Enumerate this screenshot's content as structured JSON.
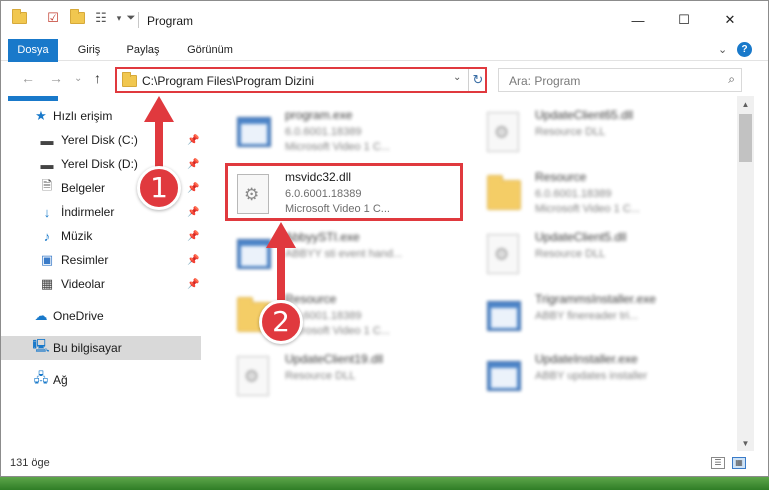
{
  "titlebar": {
    "title": "Program",
    "minimize_label": "—",
    "maximize_label": "☐",
    "close_label": "✕"
  },
  "ribbon": {
    "tabs": [
      "Dosya",
      "Giriş",
      "Paylaş",
      "Görünüm"
    ],
    "expand_label": "⌄",
    "help_label": "?"
  },
  "navbar": {
    "back_label": "←",
    "forward_label": "→",
    "recent_label": "⌄",
    "up_label": "↑",
    "address": "C:\\Program Files\\Program Dizini",
    "search_placeholder": "Ara: Program"
  },
  "sidebar": {
    "items": [
      {
        "label": "Hızlı erişim",
        "icon": "star-icon"
      },
      {
        "label": "Yerel Disk (C:)",
        "icon": "drive-icon",
        "pinned": true
      },
      {
        "label": "Yerel Disk (D:)",
        "icon": "drive-icon",
        "pinned": true
      },
      {
        "label": "Belgeler",
        "icon": "documents-icon",
        "pinned": true
      },
      {
        "label": "İndirmeler",
        "icon": "download-icon",
        "pinned": true
      },
      {
        "label": "Müzik",
        "icon": "music-icon",
        "pinned": true
      },
      {
        "label": "Resimler",
        "icon": "pictures-icon",
        "pinned": true
      },
      {
        "label": "Videolar",
        "icon": "videos-icon",
        "pinned": true
      },
      {
        "label": "OneDrive",
        "icon": "cloud-icon"
      },
      {
        "label": "Bu bilgisayar",
        "icon": "computer-icon",
        "selected": true
      },
      {
        "label": "Ağ",
        "icon": "network-icon"
      }
    ]
  },
  "files": [
    {
      "name": "program.exe",
      "line1": "6.0.6001.18389",
      "line2": "Microsoft Video 1 C...",
      "icon": "exe-icon"
    },
    {
      "name": "UpdateClient65.dll",
      "line1": "Resource DLL",
      "line2": "",
      "icon": "dll-icon"
    },
    {
      "name": "msvidc32.dll",
      "line1": "6.0.6001.18389",
      "line2": "Microsoft Video 1 C...",
      "icon": "dll-icon"
    },
    {
      "name": "Resource",
      "line1": "6.0.6001.18389",
      "line2": "Microsoft Video 1 C...",
      "icon": "folder-icon"
    },
    {
      "name": "AbbyySTI.exe",
      "line1": "ABBYY sti event hand...",
      "line2": "",
      "icon": "exe-icon"
    },
    {
      "name": "UpdateClient5.dll",
      "line1": "Resource DLL",
      "line2": "",
      "icon": "dll-icon"
    },
    {
      "name": "Resource",
      "line1": "6.0.6001.18389",
      "line2": "Microsoft Video 1 C...",
      "icon": "folder-icon"
    },
    {
      "name": "TrigrammsInstaller.exe",
      "line1": "ABBY finereader tri...",
      "line2": "",
      "icon": "exe-icon"
    },
    {
      "name": "UpdateClient19.dll",
      "line1": "Resource DLL",
      "line2": "",
      "icon": "dll-icon"
    },
    {
      "name": "UpdateInstaller.exe",
      "line1": "ABBY updates installer",
      "line2": "",
      "icon": "exe-icon"
    }
  ],
  "status": {
    "item_count": "131 öge"
  },
  "callouts": {
    "step1": "1",
    "step2": "2",
    "color": "#e0393e"
  },
  "colors": {
    "accent": "#1979ca",
    "highlight": "#e0393e"
  }
}
